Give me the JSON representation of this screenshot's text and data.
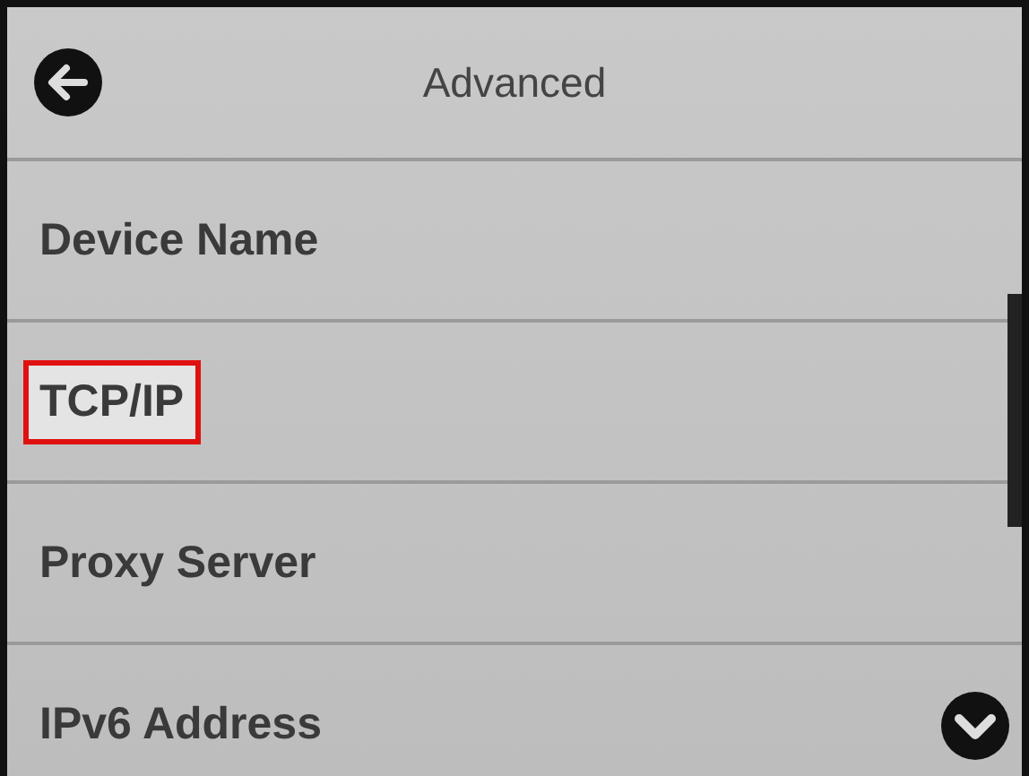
{
  "header": {
    "title": "Advanced"
  },
  "items": [
    {
      "label": "Device Name",
      "highlighted": false
    },
    {
      "label": "TCP/IP",
      "highlighted": true
    },
    {
      "label": "Proxy Server",
      "highlighted": false
    },
    {
      "label": "IPv6 Address",
      "highlighted": false
    }
  ]
}
